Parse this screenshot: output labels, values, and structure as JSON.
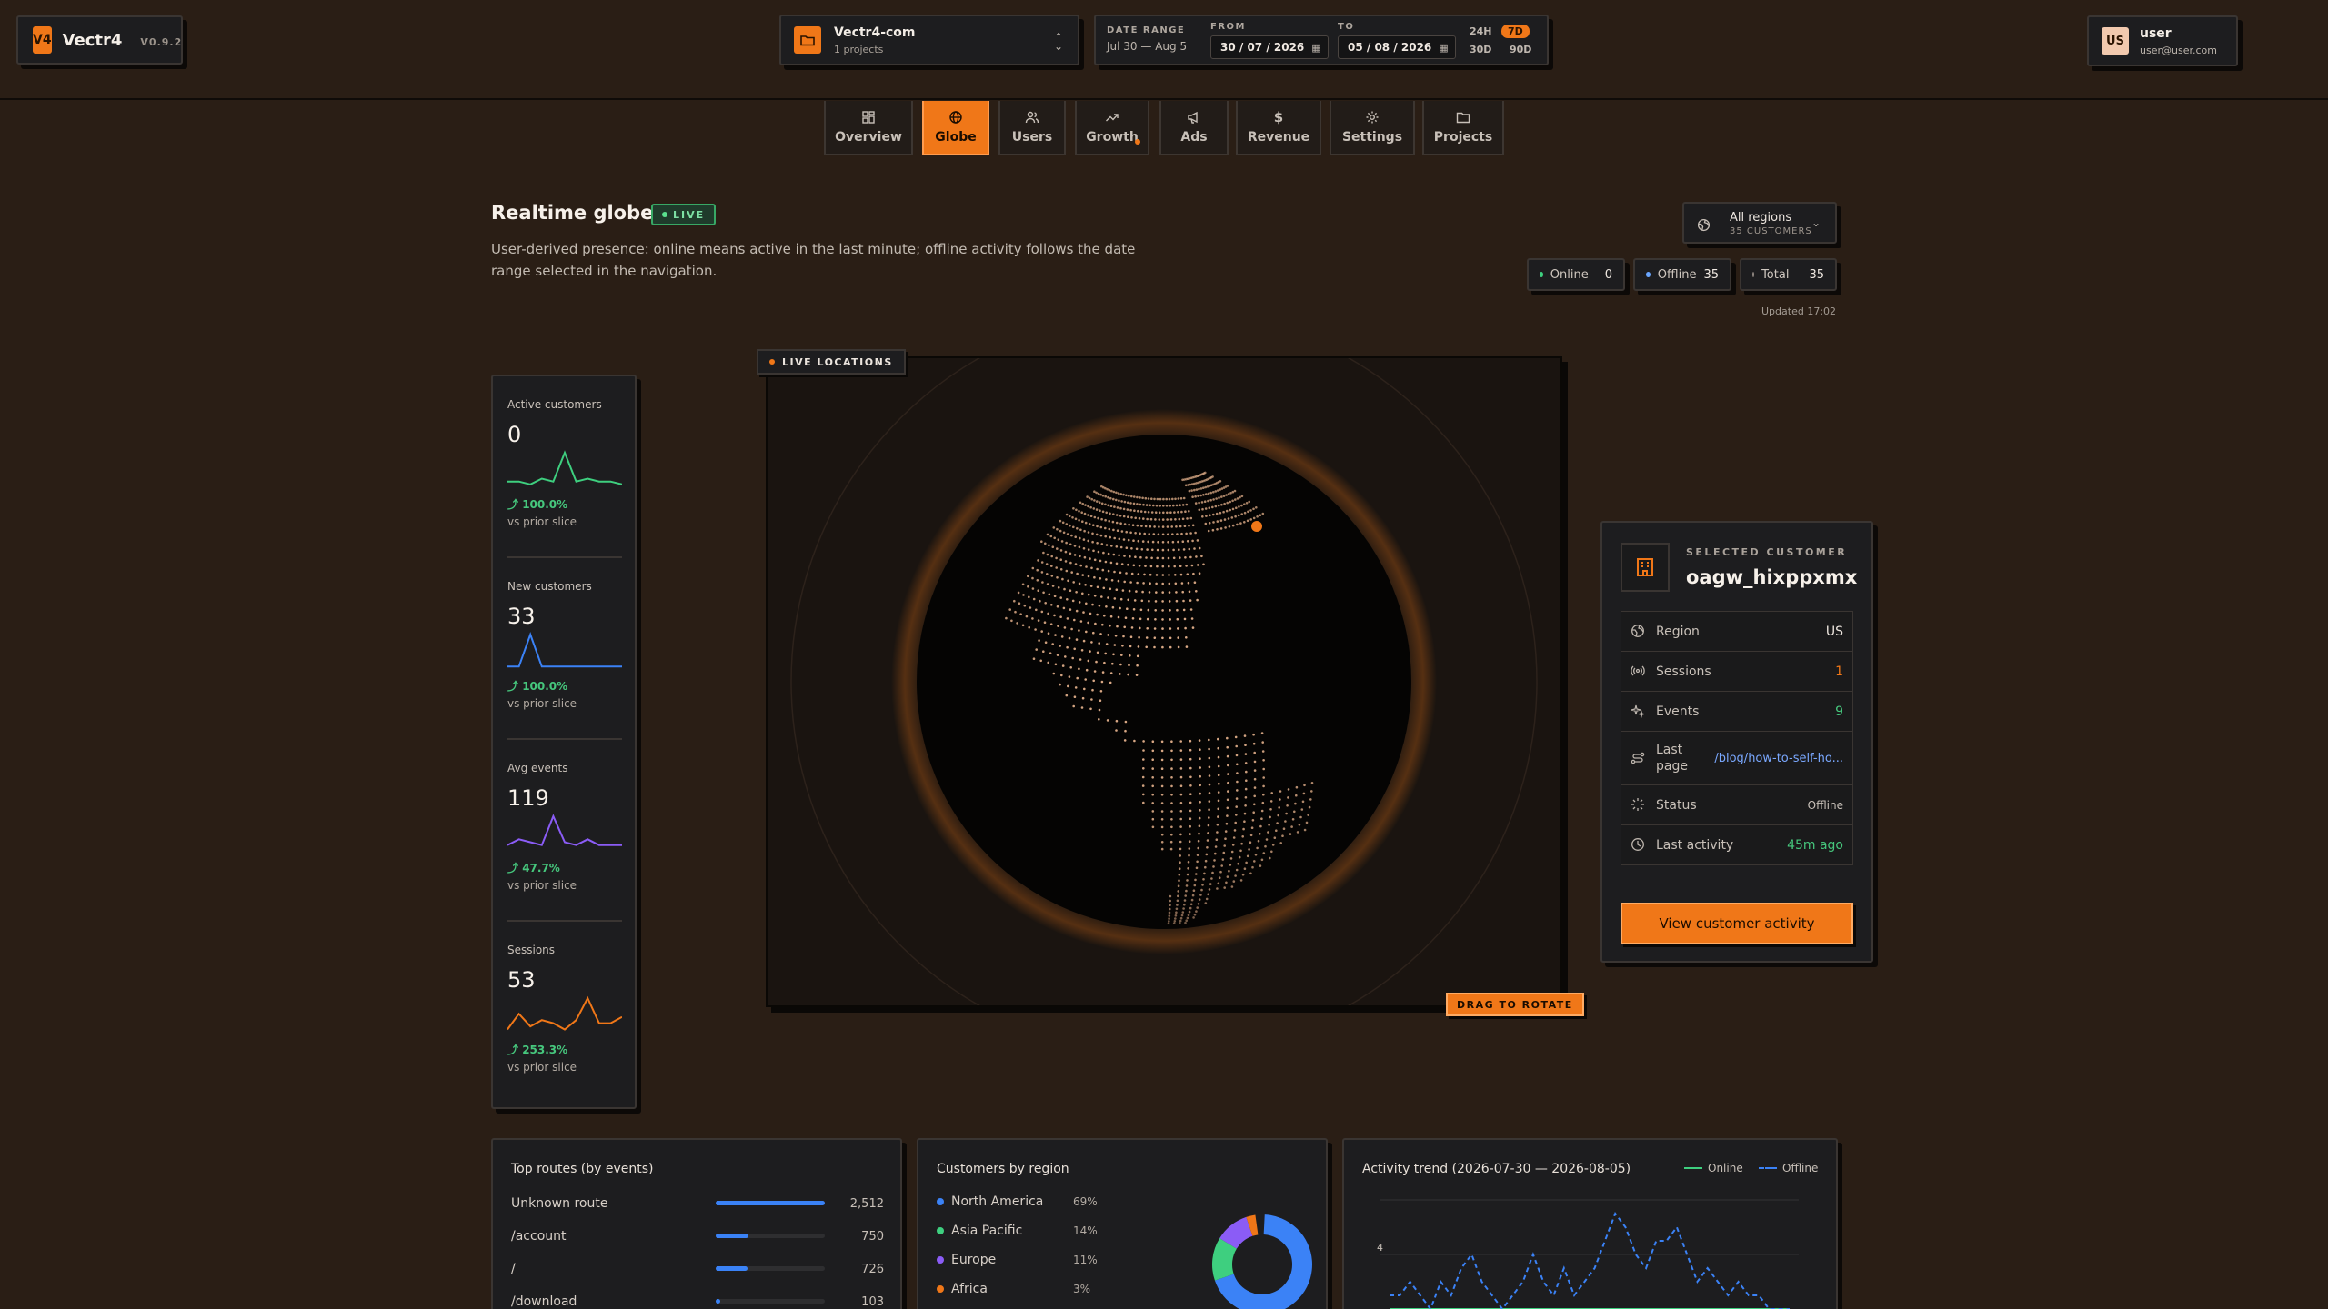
{
  "app": {
    "logo": "V4",
    "name": "Vectr4",
    "version": "V0.9.2"
  },
  "project": {
    "name": "Vectr4-com",
    "sub": "1 projects"
  },
  "date_range": {
    "label": "DATE RANGE",
    "summary": "Jul 30 — Aug 5",
    "from_label": "FROM",
    "from": "30 / 07 / 2026",
    "to_label": "TO",
    "to": "05 / 08 / 2026",
    "presets": [
      "24H",
      "7D",
      "30D",
      "90D"
    ],
    "active_preset": "7D"
  },
  "user": {
    "initials": "US",
    "name": "user",
    "email": "user@user.com"
  },
  "nav": {
    "tabs": [
      "Overview",
      "Globe",
      "Users",
      "Growth",
      "Ads",
      "Revenue",
      "Settings",
      "Projects"
    ],
    "active": "Globe"
  },
  "header": {
    "title": "Realtime globe",
    "live": "LIVE",
    "description": "User-derived presence: online means active in the last minute; offline activity follows the date range selected in the navigation.",
    "region_select": {
      "label": "All regions",
      "sub": "35 CUSTOMERS"
    },
    "stats": {
      "online_label": "Online",
      "online": "0",
      "offline_label": "Offline",
      "offline": "35",
      "total_label": "Total",
      "total": "35"
    },
    "updated": "Updated 17:02"
  },
  "kpis": [
    {
      "label": "Active customers",
      "value": "0",
      "change": "100.0%",
      "vs": "vs prior slice",
      "color": "#3ecf7f",
      "spark": [
        2,
        2,
        1,
        3,
        2,
        12,
        2,
        3,
        2,
        2,
        1
      ]
    },
    {
      "label": "New customers",
      "value": "33",
      "change": "100.0%",
      "vs": "vs prior slice",
      "color": "#3b82f6",
      "spark": [
        1,
        1,
        14,
        1,
        1,
        1,
        1,
        1,
        1,
        1,
        1
      ]
    },
    {
      "label": "Avg events",
      "value": "119",
      "change": "47.7%",
      "vs": "vs prior slice",
      "color": "#8b5cf6",
      "spark": [
        2,
        4,
        3,
        2,
        12,
        3,
        2,
        4,
        2,
        2,
        2
      ]
    },
    {
      "label": "Sessions",
      "value": "53",
      "change": "253.3%",
      "vs": "vs prior slice",
      "color": "#f07718",
      "spark": [
        1,
        6,
        2,
        4,
        3,
        1,
        4,
        11,
        3,
        3,
        5
      ]
    }
  ],
  "globe": {
    "chip": "LIVE LOCATIONS",
    "drag": "DRAG TO ROTATE",
    "accent": "#f07718"
  },
  "selected": {
    "label": "SELECTED CUSTOMER",
    "name": "oagw_hixppxmx",
    "rows": [
      {
        "label": "Region",
        "value": "US",
        "icon": "globe-icon"
      },
      {
        "label": "Sessions",
        "value": "1",
        "icon": "broadcast-icon"
      },
      {
        "label": "Events",
        "value": "9",
        "icon": "sparkle-icon"
      },
      {
        "label": "Last page",
        "value": "/blog/how-to-self-ho...",
        "icon": "route-icon"
      },
      {
        "label": "Status",
        "value": "Offline",
        "icon": "status-icon"
      },
      {
        "label": "Last activity",
        "value": "45m ago",
        "icon": "clock-icon"
      }
    ],
    "button": "View customer activity"
  },
  "top_routes": {
    "title": "Top routes (by events)",
    "items": [
      {
        "route": "Unknown route",
        "count": "2,512",
        "share": 1.0
      },
      {
        "route": "/account",
        "count": "750",
        "share": 0.3
      },
      {
        "route": "/",
        "count": "726",
        "share": 0.29
      },
      {
        "route": "/download",
        "count": "103",
        "share": 0.04
      }
    ]
  },
  "regions": {
    "title": "Customers by region",
    "items": [
      {
        "name": "North America",
        "pct": "69%",
        "value": 69,
        "color": "#3b82f6"
      },
      {
        "name": "Asia Pacific",
        "pct": "14%",
        "value": 14,
        "color": "#3ecf7f"
      },
      {
        "name": "Europe",
        "pct": "11%",
        "value": 11,
        "color": "#8b5cf6"
      },
      {
        "name": "Africa",
        "pct": "3%",
        "value": 3,
        "color": "#f07718"
      }
    ]
  },
  "trend": {
    "title": "Activity trend (2026-07-30 — 2026-08-05)",
    "legend_online": "Online",
    "legend_offline": "Offline",
    "tick": "4"
  },
  "chart_data": {
    "type": "line",
    "title": "Activity trend (2026-07-30 — 2026-08-05)",
    "series": [
      {
        "name": "Online",
        "values": [
          0,
          0,
          0,
          0,
          0,
          0,
          0,
          0,
          0,
          0,
          0,
          0,
          0,
          0,
          0,
          0,
          0,
          0,
          0,
          0,
          0,
          0,
          0,
          0,
          0,
          0,
          0,
          0,
          0,
          0,
          0,
          0,
          0,
          0,
          0,
          0,
          0,
          0,
          0,
          0
        ]
      },
      {
        "name": "Offline",
        "values": [
          1,
          1,
          2,
          1,
          0,
          2,
          1,
          3,
          4,
          2,
          1,
          0,
          1,
          2,
          4,
          2,
          1,
          3,
          1,
          2,
          3,
          5,
          7,
          6,
          4,
          3,
          5,
          5,
          6,
          4,
          2,
          3,
          2,
          1,
          2,
          1,
          1,
          0,
          0,
          0
        ]
      }
    ],
    "ylim": [
      0,
      8
    ],
    "yticks": [
      4
    ]
  }
}
